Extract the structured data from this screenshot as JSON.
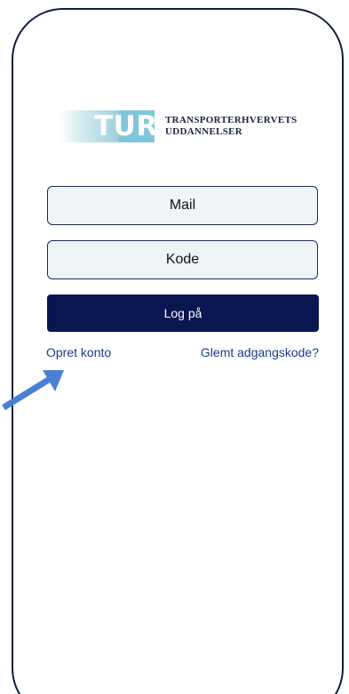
{
  "logo": {
    "mark_text": "TUR",
    "org_line1": "TRANSPORTERHVERVETS",
    "org_line2": "UDDANNELSER"
  },
  "form": {
    "mail_placeholder": "Mail",
    "password_placeholder": "Kode",
    "login_label": "Log på"
  },
  "links": {
    "create_account": "Opret konto",
    "forgot_password": "Glemt adgangskode?"
  },
  "colors": {
    "frame": "#0f1d45",
    "button": "#0a1650",
    "field_bg": "#eef4f8",
    "link": "#1b3a8c",
    "annotation_arrow": "#4a7fd6"
  },
  "annotation": {
    "icon": "arrow-pointer-icon"
  }
}
